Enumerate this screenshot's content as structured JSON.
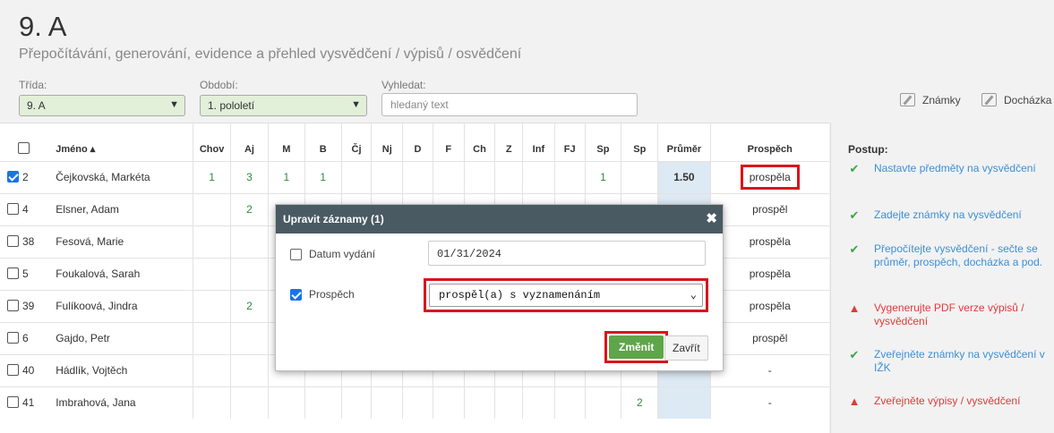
{
  "page": {
    "title": "9. A",
    "subtitle": "Přepočítávání, generování, evidence a přehled vysvědčení / výpisů / osvědčení"
  },
  "filters": {
    "class_label": "Třída:",
    "class_value": "9. A",
    "period_label": "Období:",
    "period_value": "1. pololetí",
    "search_label": "Vyhledat:",
    "search_placeholder": "hledaný text"
  },
  "toplinks": {
    "grades": "Známky",
    "attendance": "Docházka"
  },
  "table": {
    "columns": [
      "Jméno ▴",
      "Chov",
      "Aj",
      "M",
      "B",
      "Čj",
      "Nj",
      "D",
      "F",
      "Ch",
      "Z",
      "Inf",
      "FJ",
      "Sp",
      "Sp",
      "Průměr",
      "Prospěch"
    ],
    "rows": [
      {
        "id": "2",
        "checked": true,
        "name": "Čejkovská, Markéta",
        "cells": [
          "1",
          "3",
          "1",
          "1",
          "",
          "",
          "",
          "",
          "",
          "",
          "",
          "",
          "1",
          ""
        ],
        "avg": "1.50",
        "result": "prospěla",
        "highlight": true
      },
      {
        "id": "4",
        "checked": false,
        "name": "Elsner, Adam",
        "cells": [
          "",
          "2",
          "",
          "",
          "",
          "",
          "",
          "",
          "",
          "",
          "",
          "",
          "",
          ""
        ],
        "avg": "",
        "result": "prospěl",
        "highlight": false
      },
      {
        "id": "38",
        "checked": false,
        "name": "Fesová, Marie",
        "cells": [
          "",
          "",
          "",
          "",
          "",
          "",
          "",
          "",
          "",
          "",
          "",
          "",
          "",
          ""
        ],
        "avg": "",
        "result": "prospěla",
        "highlight": false
      },
      {
        "id": "5",
        "checked": false,
        "name": "Foukalová, Sarah",
        "cells": [
          "",
          "",
          "",
          "",
          "",
          "",
          "",
          "",
          "",
          "",
          "",
          "",
          "",
          ""
        ],
        "avg": "",
        "result": "prospěla",
        "highlight": false
      },
      {
        "id": "39",
        "checked": false,
        "name": "Fulíkoová, Jindra",
        "cells": [
          "",
          "2",
          "",
          "",
          "",
          "",
          "",
          "",
          "",
          "",
          "",
          "",
          "",
          ""
        ],
        "avg": "",
        "result": "prospěla",
        "highlight": false
      },
      {
        "id": "6",
        "checked": false,
        "name": "Gajdo, Petr",
        "cells": [
          "",
          "",
          "",
          "",
          "",
          "",
          "",
          "",
          "",
          "",
          "",
          "",
          "",
          ""
        ],
        "avg": "",
        "result": "prospěl",
        "highlight": false
      },
      {
        "id": "40",
        "checked": false,
        "name": "Hádlík, Vojtěch",
        "cells": [
          "",
          "",
          "",
          "",
          "",
          "",
          "",
          "",
          "",
          "",
          "",
          "",
          "",
          ""
        ],
        "avg": "",
        "result": "-",
        "highlight": false
      },
      {
        "id": "41",
        "checked": false,
        "name": "Imbrahová, Jana",
        "cells": [
          "",
          "",
          "",
          "",
          "",
          "",
          "",
          "",
          "",
          "",
          "",
          "",
          "",
          "2"
        ],
        "avg": "",
        "result": "-",
        "highlight": false
      }
    ]
  },
  "sidebar": {
    "heading": "Postup:",
    "steps": [
      {
        "status": "ok",
        "text": "Nastavte předměty na vysvědčení"
      },
      {
        "status": "ok",
        "text": "Zadejte známky na vysvědčení"
      },
      {
        "status": "ok",
        "text": "Přepočítejte vysvědčení - sečte se průměr, prospěch, docházka a pod."
      },
      {
        "status": "warn",
        "text": "Vygenerujte PDF verze výpisů / vysvědčení"
      },
      {
        "status": "ok",
        "text": "Zveřejněte známky na vysvědčení v IŽK"
      },
      {
        "status": "warn",
        "text": "Zveřejněte výpisy / vysvědčení"
      }
    ]
  },
  "modal": {
    "title": "Upravit záznamy (1)",
    "close": "✖",
    "date_label": "Datum vydání",
    "date_value": "01/31/2024",
    "result_label": "Prospěch",
    "result_value": "prospěl(a) s vyznamenáním",
    "save_label": "Změnit",
    "cancel_label": "Zavřít"
  }
}
